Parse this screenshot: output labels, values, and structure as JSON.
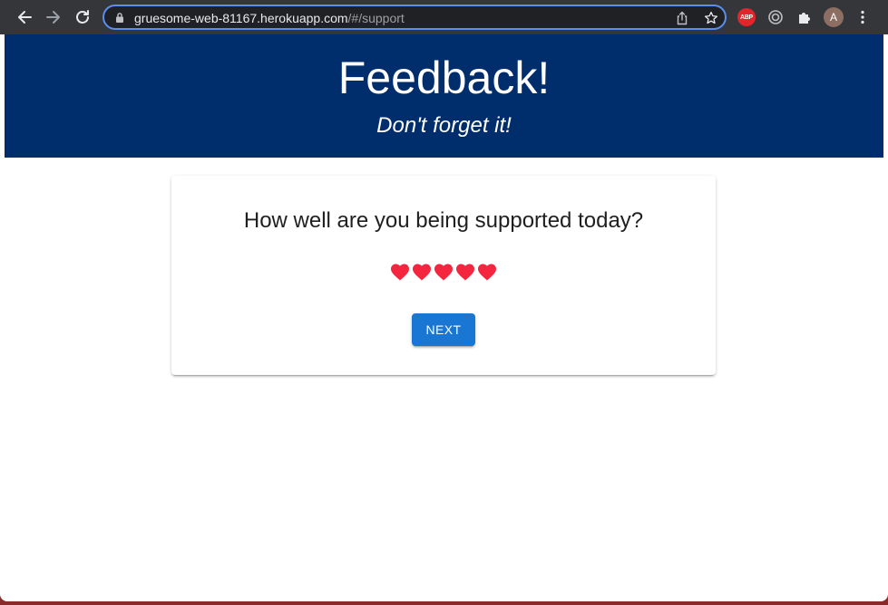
{
  "browser": {
    "url_host": "gruesome-web-81167.herokuapp.com",
    "url_path": "/#/support",
    "extensions": [
      "abp-icon",
      "target-icon",
      "puzzle-icon"
    ],
    "avatar_letter": "A",
    "adblock_label": "ABP"
  },
  "header": {
    "title": "Feedback!",
    "subtitle": "Don't forget it!"
  },
  "survey": {
    "question": "How well are you being supported today?",
    "rating": {
      "max": 5,
      "value": 5
    },
    "next_label": "NEXT"
  },
  "colors": {
    "header_bg": "#002d6b",
    "heart": "#f4263f",
    "button": "#1976d2"
  }
}
